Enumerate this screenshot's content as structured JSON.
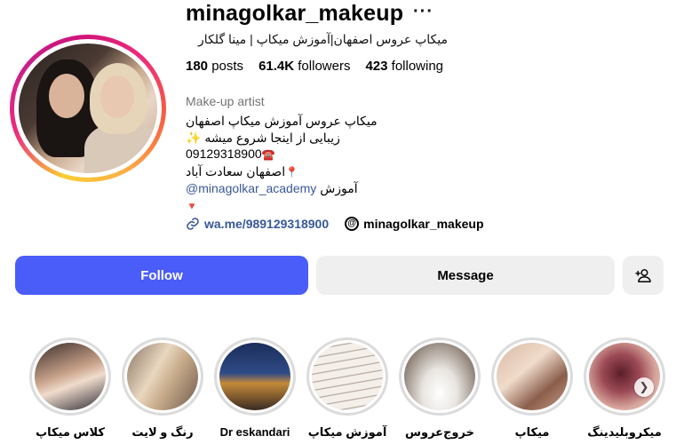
{
  "profile": {
    "username": "minagolkar_makeup",
    "full_name": "میکاپ عروس اصفهان|آموزش میکاپ | مینا گلکار",
    "stats": {
      "posts_count": "180",
      "posts_label": "posts",
      "followers_count": "61.4K",
      "followers_label": "followers",
      "following_count": "423",
      "following_label": "following"
    },
    "category": "Make-up artist",
    "bio": {
      "line1": "میکاپ عروس آموزش میکاپ اصفهان",
      "line2": "زیبایی از اینجا شروع میشه",
      "line2_emoji": "✨",
      "line3_emoji": "☎️",
      "line3": "09129318900",
      "line4_emoji": "📍",
      "line4": "اصفهان سعادت آباد",
      "line5": "آموزش",
      "line5_link": "minagolkar_academy@",
      "line6_emoji": "🔻"
    },
    "website": "wa.me/989129318900",
    "threads_handle": "minagolkar_makeup"
  },
  "actions": {
    "follow_label": "Follow",
    "message_label": "Message",
    "more_symbol": "···"
  },
  "highlights": [
    {
      "label": "کلاس میکاپ"
    },
    {
      "label": "رنگ و لایت"
    },
    {
      "label": "Dr eskandari"
    },
    {
      "label": "آموزش میکاپ"
    },
    {
      "label": "خروج‌عروس"
    },
    {
      "label": "میکاپ"
    },
    {
      "label": "میکروبلیدینگ"
    }
  ],
  "colors": {
    "follow_button": "#4a5df9",
    "link": "#385898",
    "secondary_button": "#efefef"
  }
}
